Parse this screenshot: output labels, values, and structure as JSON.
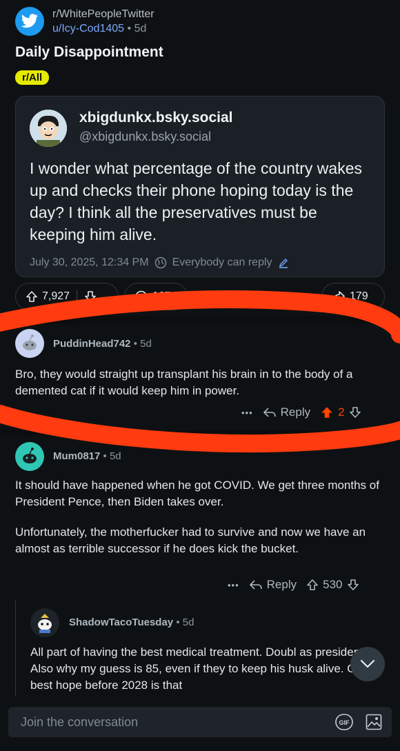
{
  "post": {
    "subreddit": "r/WhitePeopleTwitter",
    "author": "u/Icy-Cod1405",
    "age": "• 5d",
    "title": "Daily Disappointment",
    "flair": "r/All"
  },
  "embed": {
    "handle": "xbigdunkx.bsky.social",
    "at": "@xbigdunkx.bsky.social",
    "text": "I wonder what percentage of the country wakes up and checks their phone hoping today is the day? I think all the preservatives must be keeping him alive.",
    "date": "July 30, 2025, 12:34 PM",
    "reply_setting": "Everybody can reply"
  },
  "actions": {
    "upvotes": "7,927",
    "comments": "167",
    "shares": "179"
  },
  "comments": [
    {
      "user": "PuddinHead742",
      "age": "• 5d",
      "body": "Bro, they would straight up transplant his brain in to the body of a demented cat if it would keep him in power.",
      "more": "•••",
      "reply": "Reply",
      "votes": "2"
    },
    {
      "user": "Mum0817",
      "age": "• 5d",
      "body1": "It should have happened when he got COVID. We get three months of President Pence, then Biden takes over.",
      "body2": "Unfortunately, the motherfucker had to survive and now we have an almost as terrible successor if he does kick the bucket.",
      "more": "•••",
      "reply": "Reply",
      "votes": "530"
    },
    {
      "user": "ShadowTacoTuesday",
      "age": "• 5d",
      "body": "All part of having the best medical treatment.  Doubl as president.  Also why my guess is 85, even if they to keep his husk alive.  Our best hope before 2028 is that"
    }
  ],
  "composer": {
    "placeholder": "Join the conversation"
  },
  "colors": {
    "bg": "#0e1113",
    "upvote_active": "#ff4500",
    "annotation": "#ff3b0f"
  }
}
